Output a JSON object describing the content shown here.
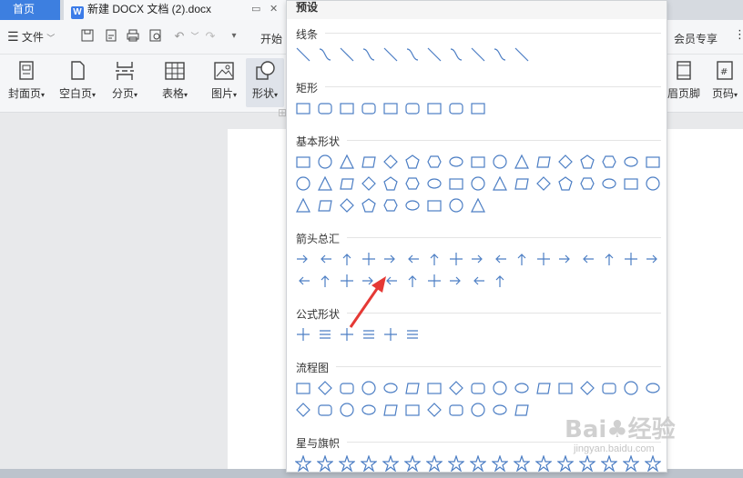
{
  "titlebar": {
    "home_tab": "首页",
    "doc_tab": "新建 DOCX 文档 (2).docx",
    "doc_icon": "W"
  },
  "menubar": {
    "file": "文件",
    "start": "开始",
    "vip": "会员专享"
  },
  "ribbon": {
    "buttons": [
      {
        "label": "封面页",
        "icon": "cover-page-icon"
      },
      {
        "label": "空白页",
        "icon": "blank-page-icon"
      },
      {
        "label": "分页",
        "icon": "page-break-icon"
      },
      {
        "label": "表格",
        "icon": "table-icon"
      },
      {
        "label": "图片",
        "icon": "picture-icon"
      },
      {
        "label": "形状",
        "icon": "shape-icon"
      },
      {
        "label": "眉页脚",
        "icon": "header-footer-icon"
      },
      {
        "label": "页码",
        "icon": "page-number-icon"
      }
    ]
  },
  "panel": {
    "header": "预设",
    "sections": [
      {
        "title": "线条",
        "rows": [
          11
        ]
      },
      {
        "title": "矩形",
        "rows": [
          9
        ]
      },
      {
        "title": "基本形状",
        "rows": [
          17,
          17,
          9
        ]
      },
      {
        "title": "箭头总汇",
        "rows": [
          17,
          10
        ]
      },
      {
        "title": "公式形状",
        "rows": [
          6
        ]
      },
      {
        "title": "流程图",
        "rows": [
          17,
          11
        ]
      },
      {
        "title": "星与旗帜",
        "rows": [
          17
        ]
      }
    ]
  },
  "watermark": {
    "main": "Bai♣经验",
    "sub": "jingyan.baidu.com"
  },
  "colors": {
    "accent": "#3d7fe0",
    "shape_stroke": "#4c7ec4",
    "arrow": "#e53935"
  }
}
